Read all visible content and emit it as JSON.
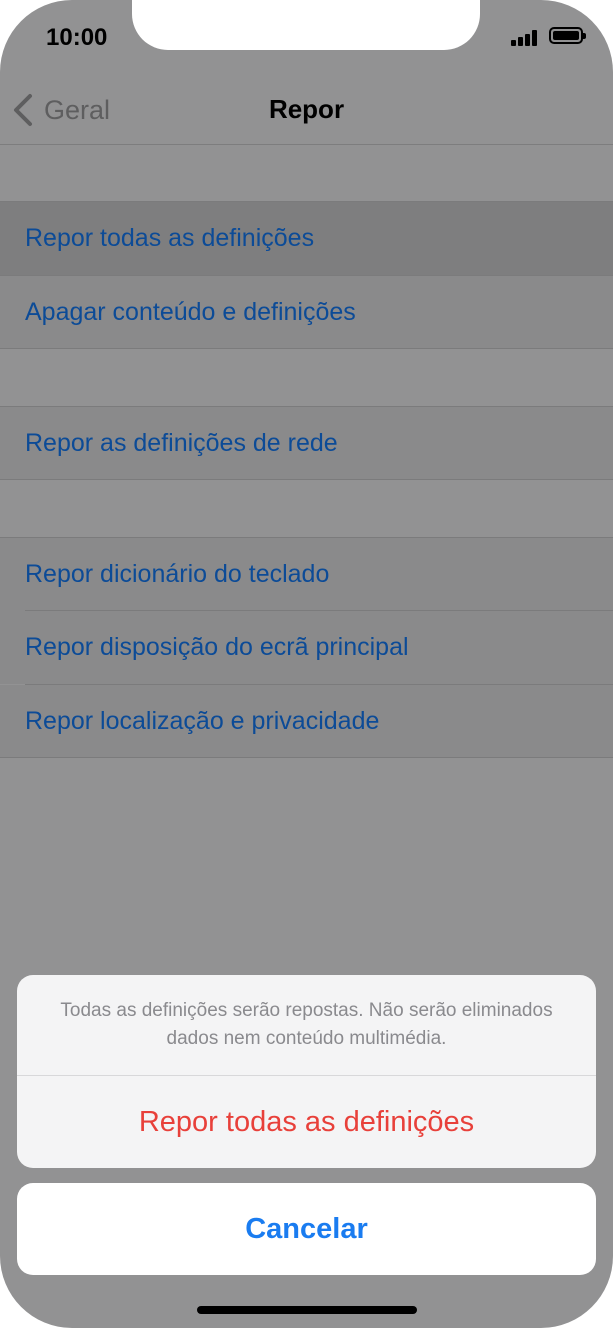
{
  "status_bar": {
    "time": "10:00"
  },
  "nav": {
    "back_label": "Geral",
    "title": "Repor"
  },
  "list": {
    "reset_all": "Repor todas as definições",
    "erase_all": "Apagar conteúdo e definições",
    "reset_network": "Repor as definições de rede",
    "reset_keyboard": "Repor dicionário do teclado",
    "reset_home_layout": "Repor disposição do ecrã principal",
    "reset_location_privacy": "Repor localização e privacidade"
  },
  "action_sheet": {
    "message": "Todas as definições serão repostas. Não serão eliminados dados nem conteúdo multimédia.",
    "destructive_label": "Repor todas as definições",
    "cancel_label": "Cancelar"
  },
  "colors": {
    "link_blue": "#0c4b97",
    "destructive_red": "#e8403a",
    "cancel_blue": "#1a7cf0",
    "dim_background": "#929293"
  }
}
